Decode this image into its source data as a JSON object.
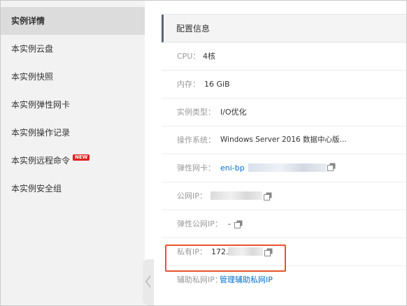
{
  "sidebar": {
    "items": [
      {
        "label": "实例详情",
        "active": true
      },
      {
        "label": "本实例云盘"
      },
      {
        "label": "本实例快照"
      },
      {
        "label": "本实例弹性网卡"
      },
      {
        "label": "本实例操作记录"
      },
      {
        "label": "本实例远程命令",
        "badge": "NEW"
      },
      {
        "label": "本实例安全组"
      }
    ],
    "collapse_icon": "chevron-left-icon"
  },
  "config": {
    "title": "配置信息",
    "rows": {
      "cpu": {
        "label": "CPU：",
        "value": "4核"
      },
      "memory": {
        "label": "内存：",
        "value": "16 GiB"
      },
      "instance_type": {
        "label": "实例类型：",
        "value": "I/O优化"
      },
      "os": {
        "label": "操作系统：",
        "value": "Windows Server 2016 数据中心版..."
      },
      "eni": {
        "label": "弹性网卡：",
        "value": "eni-bp"
      },
      "public_ip": {
        "label": "公网IP："
      },
      "eip": {
        "label": "弹性公网IP：",
        "value": "-"
      },
      "private_ip": {
        "label": "私有IP：",
        "value": "172."
      },
      "secondary_ip": {
        "label": "辅助私网IP：",
        "value": "管理辅助私网IP"
      }
    }
  },
  "colors": {
    "highlight": "#e8532d",
    "link": "#0070cc"
  }
}
